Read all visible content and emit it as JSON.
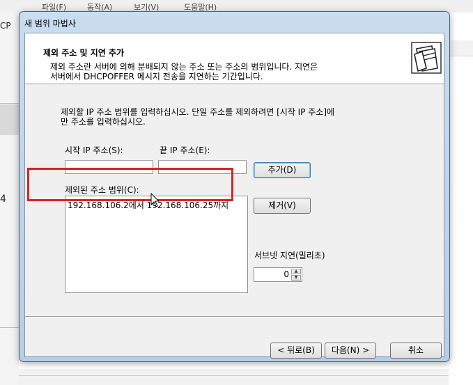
{
  "background_app": {
    "menu": [
      "파일(F)",
      "동작(A)",
      "보기(V)",
      "도움말(H)"
    ],
    "left_label": "CP",
    "left_number": "4"
  },
  "wizard": {
    "title": "새 범위 마법사",
    "header": {
      "title": "제외 주소 및 지연 추가",
      "description_line1": "제외 주소란 서버에 의해 분배되지 않는 주소 또는 주소의 범위입니다. 지연은",
      "description_line2": "서버에서 DHCPOFFER 메시지 전송을 지연하는 기간입니다.",
      "icon": "folders-icon"
    },
    "instruction_line1": "제외할 IP 주소 범위를 입력하십시오. 단일 주소를 제외하려면 [시작 IP 주소]에",
    "instruction_line2": "만 주소를 입력하십시오.",
    "start_ip_label": "시작 IP 주소(S):",
    "end_ip_label": "끝 IP 주소(E):",
    "start_ip_value": "",
    "end_ip_value": "",
    "add_button": "추가(D)",
    "excluded_label": "제외된 주소 범위(C):",
    "excluded_items": [
      "192.168.106.2에서 192.168.106.25까지"
    ],
    "remove_button": "제거(V)",
    "subnet_delay_label": "서브넷 지연(밀리초)",
    "subnet_delay_value": "0",
    "back_button": "< 뒤로(B)",
    "next_button": "다음(N) >",
    "cancel_button": "취소"
  },
  "colors": {
    "highlight": "#e02020",
    "title_gradient_top": "#c9ddef",
    "title_gradient_bottom": "#b7cee6"
  }
}
